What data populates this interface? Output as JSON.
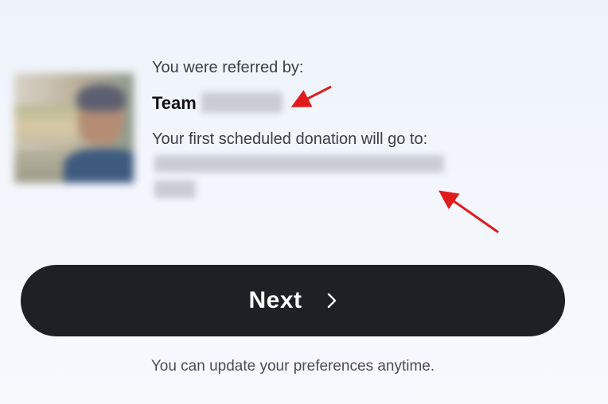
{
  "referral": {
    "label": "You were referred by:",
    "team_prefix": "Team",
    "team_name": "",
    "avatar_icon": "referrer-photo"
  },
  "donation": {
    "label": "Your first scheduled donation will go to:",
    "recipient": ""
  },
  "annotations": {
    "arrow_color": "#e11b1b"
  },
  "actions": {
    "next_label": "Next",
    "next_icon": "chevron-right-icon"
  },
  "footer": {
    "note": "You can update your preferences anytime."
  },
  "colors": {
    "button_bg": "#1e2026",
    "button_text": "#ffffff"
  }
}
